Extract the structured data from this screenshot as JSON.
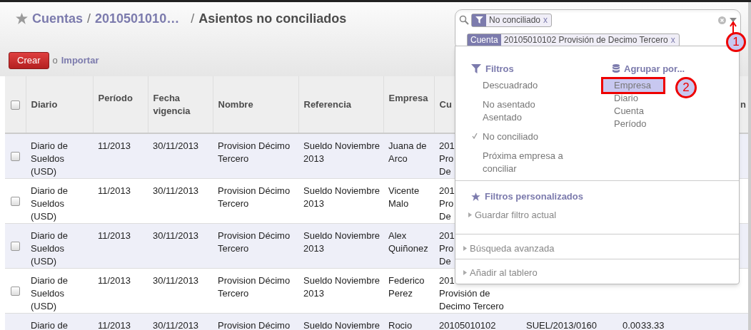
{
  "breadcrumb": {
    "separator": "/",
    "items": [
      {
        "text": "Cuentas",
        "kind": "link"
      },
      {
        "text": "2010501010…",
        "kind": "link"
      },
      {
        "text": "Asientos no conciliados",
        "kind": "current"
      }
    ]
  },
  "actions": {
    "create": "Crear",
    "or": "o",
    "import": "Importar"
  },
  "search": {
    "facets": [
      {
        "kind": "filter",
        "value": "No conciliado",
        "remove": "x"
      },
      {
        "kind": "field",
        "label": "Cuenta",
        "value": "20105010102 Provisión de Decimo Tercero",
        "remove": "x"
      }
    ]
  },
  "dropdown": {
    "filters": {
      "title": "Filtros",
      "groups": [
        [
          {
            "label": "Descuadrado",
            "checked": false
          }
        ],
        [
          {
            "label": "No asentado",
            "checked": false
          },
          {
            "label": "Asentado",
            "checked": false
          }
        ],
        [
          {
            "label": "No conciliado",
            "checked": true
          }
        ],
        [
          {
            "label": "Próxima empresa a conciliar",
            "checked": false
          }
        ]
      ]
    },
    "group_by": {
      "title": "Agrupar por...",
      "items": [
        {
          "label": "Empresa",
          "selected": true
        },
        {
          "label": "Diario",
          "selected": false
        },
        {
          "label": "Cuenta",
          "selected": false
        },
        {
          "label": "Período",
          "selected": false
        }
      ]
    },
    "custom_filters": {
      "title": "Filtros personalizados",
      "items": [
        "Guardar filtro actual"
      ]
    },
    "sections": [
      "Búsqueda avanzada",
      "Añadir al tablero"
    ]
  },
  "annotations": [
    {
      "label": "1"
    },
    {
      "label": "2"
    }
  ],
  "table": {
    "all_checked": false,
    "columns": [
      {
        "label": "Diario"
      },
      {
        "label": "Período"
      },
      {
        "label": "Fecha vigencia"
      },
      {
        "label": "Nombre"
      },
      {
        "label": "Referencia"
      },
      {
        "label": "Empresa"
      },
      {
        "label": "Cu"
      },
      {},
      {},
      {},
      {
        "label": "n"
      }
    ],
    "rows": [
      {
        "checked": false,
        "cells": [
          "Diario de Sueldos (USD)",
          "11/2013",
          "30/11/2013",
          "Provision Décimo Tercero",
          "Sueldo Noviembre 2013",
          "Juana de Arco",
          "201\nPro\nDe",
          null,
          null,
          null,
          null
        ]
      },
      {
        "checked": false,
        "cells": [
          "Diario de Sueldos (USD)",
          "11/2013",
          "30/11/2013",
          "Provision Décimo Tercero",
          "Sueldo Noviembre 2013",
          "Vicente Malo",
          "201\nPro\nDe",
          null,
          null,
          null,
          null
        ]
      },
      {
        "checked": false,
        "cells": [
          "Diario de Sueldos (USD)",
          "11/2013",
          "30/11/2013",
          "Provision Décimo Tercero",
          "Sueldo Noviembre 2013",
          "Alex Quiñonez",
          "201\nPro\nDe",
          null,
          null,
          null,
          null
        ]
      },
      {
        "checked": false,
        "cells": [
          "Diario de Sueldos (USD)",
          "11/2013",
          "30/11/2013",
          "Provision Décimo Tercero",
          "Sueldo Noviembre 2013",
          "Federico Perez",
          "201\nProvisión de\nDecimo Tercero",
          null,
          null,
          null,
          null
        ]
      },
      {
        "cells": [
          "Diario de",
          "11/2013",
          "30/11/2013",
          "Provision Décimo",
          "Sueldo Noviembre",
          "Rocio",
          "20105010102",
          "SUEL/2013/0160",
          "0.00",
          "33.33",
          null
        ]
      }
    ]
  }
}
